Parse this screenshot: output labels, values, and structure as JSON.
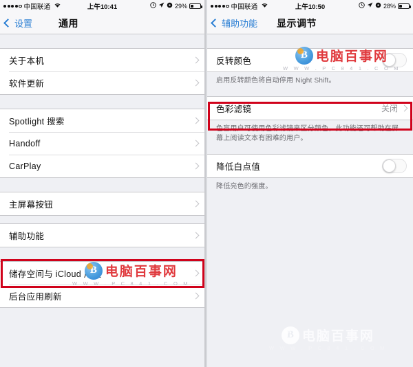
{
  "left_phone": {
    "status_bar": {
      "signal_dots_filled": 4,
      "signal_dots_empty": 1,
      "carrier": "中国联通",
      "wifi_icon": "wifi-icon",
      "time": "上午10:41",
      "icons": [
        "alarm-icon",
        "location-arrow-icon",
        "rotation-lock-icon"
      ],
      "battery_percent": "29%",
      "battery_level": 29
    },
    "nav": {
      "back_label": "设置",
      "title": "通用"
    },
    "groups": [
      {
        "rows": [
          {
            "label": "关于本机",
            "accessory": "chevron"
          },
          {
            "label": "软件更新",
            "accessory": "chevron"
          }
        ]
      },
      {
        "rows": [
          {
            "label": "Spotlight 搜索",
            "accessory": "chevron"
          },
          {
            "label": "Handoff",
            "accessory": "chevron"
          },
          {
            "label": "CarPlay",
            "accessory": "chevron"
          }
        ]
      },
      {
        "rows": [
          {
            "label": "主屏幕按钮",
            "accessory": "chevron"
          }
        ]
      },
      {
        "rows": [
          {
            "label": "辅助功能",
            "accessory": "chevron",
            "highlighted": true
          }
        ]
      },
      {
        "rows": [
          {
            "label": "储存空间与 iCloud 用量",
            "accessory": "chevron"
          },
          {
            "label": "后台应用刷新",
            "accessory": "chevron"
          }
        ]
      }
    ]
  },
  "right_phone": {
    "status_bar": {
      "signal_dots_filled": 4,
      "signal_dots_empty": 1,
      "carrier": "中国联通",
      "wifi_icon": "wifi-icon",
      "time": "上午10:50",
      "icons": [
        "alarm-icon",
        "location-arrow-icon",
        "rotation-lock-icon"
      ],
      "battery_percent": "28%",
      "battery_level": 28
    },
    "nav": {
      "back_label": "辅助功能",
      "title": "显示调节"
    },
    "rows": {
      "invert_colors": {
        "label": "反转颜色",
        "toggle": "off"
      },
      "invert_colors_footnote": "启用反转颜色将自动停用 Night Shift。",
      "color_filters": {
        "label": "色彩滤镜",
        "value": "关闭",
        "accessory": "chevron",
        "highlighted": true
      },
      "color_filters_footnote": "色盲用户可使用色彩滤镜来区分颜色，此功能还可帮助在屏幕上阅读文本有困难的用户。",
      "reduce_white_point": {
        "label": "降低白点值",
        "toggle": "off"
      },
      "reduce_white_point_footnote": "降低亮色的强度。"
    }
  },
  "watermarks": {
    "main_text": "电脑百事网",
    "sub_text": "W W W . P C 8 4 1 . C O M"
  }
}
